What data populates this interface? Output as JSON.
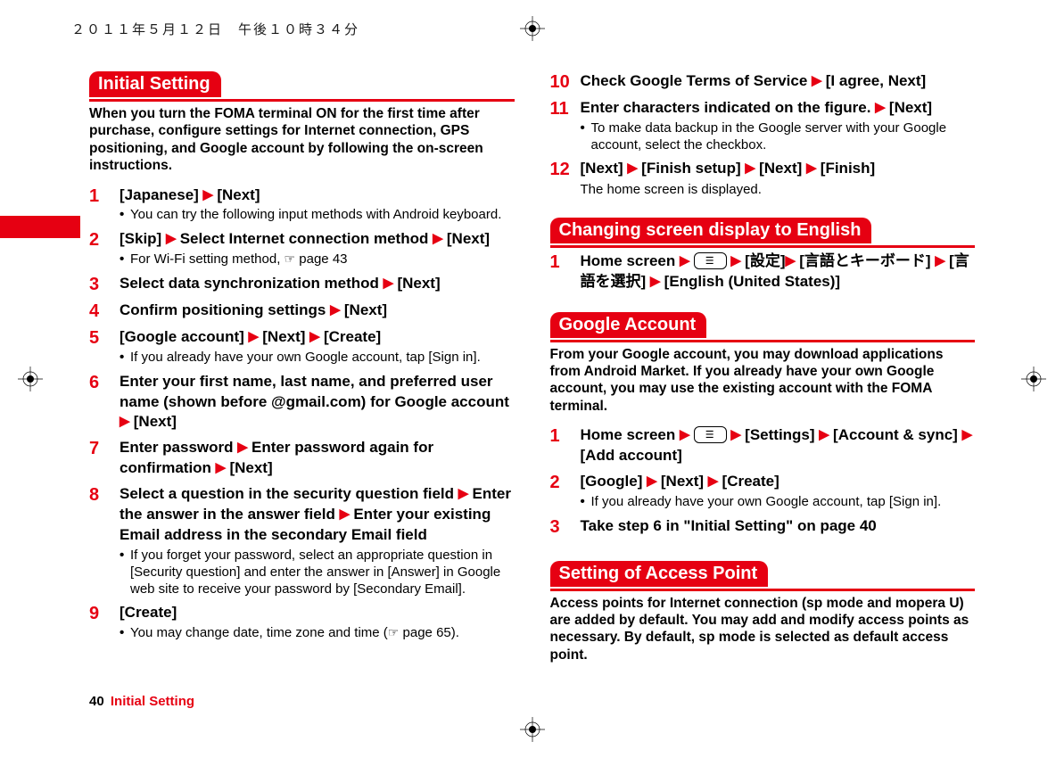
{
  "header_timestamp": "２０１１年５月１２日　午後１０時３４分",
  "footer": {
    "page": "40",
    "section": "Initial Setting"
  },
  "left": {
    "section_title": "Initial Setting",
    "intro": "When you turn the FOMA terminal ON for the first time after purchase, configure settings for Internet connection, GPS positioning, and Google account by following the on-screen instructions.",
    "steps": [
      {
        "num": "1",
        "parts": [
          {
            "t": "txt",
            "v": "[Japanese] "
          },
          {
            "t": "tri"
          },
          {
            "t": "txt",
            "v": " [Next]"
          }
        ],
        "notes": [
          "You can try the following input methods with Android keyboard."
        ]
      },
      {
        "num": "2",
        "parts": [
          {
            "t": "txt",
            "v": "[Skip] "
          },
          {
            "t": "tri"
          },
          {
            "t": "txt",
            "v": " Select Internet connection method "
          },
          {
            "t": "tri"
          },
          {
            "t": "txt",
            "v": " [Next]"
          }
        ],
        "notes_html": [
          [
            {
              "t": "txt",
              "v": "For Wi-Fi setting method, "
            },
            {
              "t": "hand"
            },
            {
              "t": "txt",
              "v": " page 43"
            }
          ]
        ]
      },
      {
        "num": "3",
        "parts": [
          {
            "t": "txt",
            "v": "Select data synchronization method "
          },
          {
            "t": "tri"
          },
          {
            "t": "txt",
            "v": " [Next]"
          }
        ]
      },
      {
        "num": "4",
        "parts": [
          {
            "t": "txt",
            "v": "Confirm positioning settings "
          },
          {
            "t": "tri"
          },
          {
            "t": "txt",
            "v": " [Next]"
          }
        ]
      },
      {
        "num": "5",
        "parts": [
          {
            "t": "txt",
            "v": "[Google account] "
          },
          {
            "t": "tri"
          },
          {
            "t": "txt",
            "v": " [Next] "
          },
          {
            "t": "tri"
          },
          {
            "t": "txt",
            "v": " [Create]"
          }
        ],
        "notes": [
          "If you already have your own Google account, tap [Sign in]."
        ]
      },
      {
        "num": "6",
        "parts": [
          {
            "t": "txt",
            "v": "Enter your first name, last name, and preferred user name (shown before @gmail.com) for Google account "
          },
          {
            "t": "tri"
          },
          {
            "t": "txt",
            "v": " [Next]"
          }
        ]
      },
      {
        "num": "7",
        "parts": [
          {
            "t": "txt",
            "v": "Enter password "
          },
          {
            "t": "tri"
          },
          {
            "t": "txt",
            "v": " Enter password again for confirmation "
          },
          {
            "t": "tri"
          },
          {
            "t": "txt",
            "v": " [Next]"
          }
        ]
      },
      {
        "num": "8",
        "parts": [
          {
            "t": "txt",
            "v": "Select a question in the security question field "
          },
          {
            "t": "tri"
          },
          {
            "t": "txt",
            "v": " Enter the answer in the answer field "
          },
          {
            "t": "tri"
          },
          {
            "t": "txt",
            "v": " Enter your existing Email address in the secondary Email field"
          }
        ],
        "notes": [
          "If you forget your password, select an appropriate question in [Security question] and enter the answer in [Answer] in Google web site to receive your password by [Secondary Email]."
        ]
      },
      {
        "num": "9",
        "parts": [
          {
            "t": "txt",
            "v": "[Create]"
          }
        ],
        "notes_html": [
          [
            {
              "t": "txt",
              "v": "You may change date, time zone and time ("
            },
            {
              "t": "hand"
            },
            {
              "t": "txt",
              "v": " page 65)."
            }
          ]
        ]
      }
    ]
  },
  "right_top_steps": [
    {
      "num": "10",
      "parts": [
        {
          "t": "txt",
          "v": "Check Google Terms of Service "
        },
        {
          "t": "tri"
        },
        {
          "t": "txt",
          "v": " [I agree, Next]"
        }
      ]
    },
    {
      "num": "11",
      "parts": [
        {
          "t": "txt",
          "v": "Enter characters indicated on the figure. "
        },
        {
          "t": "tri"
        },
        {
          "t": "txt",
          "v": " [Next]"
        }
      ],
      "notes": [
        "To make data backup in the Google server with your Google account, select the checkbox."
      ]
    },
    {
      "num": "12",
      "parts": [
        {
          "t": "txt",
          "v": "[Next] "
        },
        {
          "t": "tri"
        },
        {
          "t": "txt",
          "v": " [Finish setup] "
        },
        {
          "t": "tri"
        },
        {
          "t": "txt",
          "v": " [Next] "
        },
        {
          "t": "tri"
        },
        {
          "t": "txt",
          "v": " [Finish]"
        }
      ],
      "plain": [
        "The home screen is displayed."
      ]
    }
  ],
  "changing": {
    "title": "Changing screen display to English",
    "steps": [
      {
        "num": "1",
        "parts": [
          {
            "t": "txt",
            "v": "Home screen "
          },
          {
            "t": "tri"
          },
          {
            "t": "txt",
            "v": " "
          },
          {
            "t": "menu"
          },
          {
            "t": "txt",
            "v": " "
          },
          {
            "t": "tri"
          },
          {
            "t": "txt",
            "v": " [設定]"
          },
          {
            "t": "tri"
          },
          {
            "t": "txt",
            "v": " [言語とキーボード] "
          },
          {
            "t": "tri"
          },
          {
            "t": "txt",
            "v": " [言語を選択] "
          },
          {
            "t": "tri"
          },
          {
            "t": "txt",
            "v": " [English (United States)]"
          }
        ]
      }
    ]
  },
  "google": {
    "title": "Google Account",
    "intro": "From your Google account, you may download applications from Android Market. If you already have your own Google account, you may use the existing account with the FOMA terminal.",
    "steps": [
      {
        "num": "1",
        "parts": [
          {
            "t": "txt",
            "v": "Home screen "
          },
          {
            "t": "tri"
          },
          {
            "t": "txt",
            "v": " "
          },
          {
            "t": "menu"
          },
          {
            "t": "txt",
            "v": " "
          },
          {
            "t": "tri"
          },
          {
            "t": "txt",
            "v": " [Settings] "
          },
          {
            "t": "tri"
          },
          {
            "t": "txt",
            "v": " [Account & sync] "
          },
          {
            "t": "tri"
          },
          {
            "t": "txt",
            "v": " [Add account]"
          }
        ]
      },
      {
        "num": "2",
        "parts": [
          {
            "t": "txt",
            "v": "[Google] "
          },
          {
            "t": "tri"
          },
          {
            "t": "txt",
            "v": " [Next] "
          },
          {
            "t": "tri"
          },
          {
            "t": "txt",
            "v": " [Create]"
          }
        ],
        "notes": [
          "If you already have your own Google account, tap [Sign in]."
        ]
      },
      {
        "num": "3",
        "parts": [
          {
            "t": "txt",
            "v": "Take step 6 in \"Initial Setting\" on page 40"
          }
        ]
      }
    ]
  },
  "access": {
    "title": "Setting of Access Point",
    "intro": "Access points for Internet connection (sp mode and mopera U) are added by default. You may add and modify access points as necessary. By default, sp mode is selected as default access point."
  }
}
